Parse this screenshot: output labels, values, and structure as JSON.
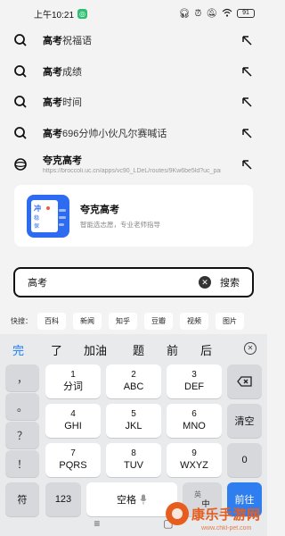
{
  "status_bar": {
    "time": "上午10:21",
    "app_badge": "",
    "battery": "91"
  },
  "suggestions": [
    {
      "highlight": "高考",
      "rest": "祝福语",
      "icon": "search-icon",
      "url": ""
    },
    {
      "highlight": "高考",
      "rest": "成绩",
      "icon": "search-icon",
      "url": ""
    },
    {
      "highlight": "高考",
      "rest": "时间",
      "icon": "search-icon",
      "url": ""
    },
    {
      "highlight": "高考",
      "rest": "696分帅小伙凡尔赛喊话",
      "icon": "search-icon",
      "url": ""
    },
    {
      "highlight": "夸克高考",
      "rest": "",
      "icon": "globe-icon",
      "url": "https://broccoli.uc.cn/apps/vc90_LDeL/routes/9Kw6be5ld?uc_par..."
    }
  ],
  "card": {
    "title": "夸克高考",
    "subtitle": "智能选志愿，专业老师指导",
    "logo_text_1": "冲",
    "logo_text_2": "稳",
    "logo_text_3": "保"
  },
  "search": {
    "value": "高考",
    "clear_icon": "x-circle-icon",
    "button_label": "搜索"
  },
  "quicklinks": {
    "label": "快搜：",
    "items": [
      "百科",
      "新闻",
      "知乎",
      "豆瓣",
      "视频",
      "图片"
    ]
  },
  "keyboard": {
    "candidates": [
      "完",
      "了",
      "加油",
      "题",
      "前",
      "后"
    ],
    "side_keys": [
      "，",
      "。",
      "？",
      "！"
    ],
    "rows": [
      [
        {
          "num": "1",
          "letters": "分词"
        },
        {
          "num": "2",
          "letters": "ABC"
        },
        {
          "num": "3",
          "letters": "DEF"
        }
      ],
      [
        {
          "num": "4",
          "letters": "GHI"
        },
        {
          "num": "5",
          "letters": "JKL"
        },
        {
          "num": "6",
          "letters": "MNO"
        }
      ],
      [
        {
          "num": "7",
          "letters": "PQRS"
        },
        {
          "num": "8",
          "letters": "TUV"
        },
        {
          "num": "9",
          "letters": "WXYZ"
        }
      ]
    ],
    "clear_label": "清空",
    "backspace_icon": "backspace-icon",
    "zero_label": "0",
    "symbol_label": "符",
    "num_label": "123",
    "space_label": "空格",
    "lang_top": "英",
    "lang_bottom": "中",
    "go_label": "前往"
  },
  "watermark": {
    "text": "康乐手游网",
    "url": "www.chkl-pet.com"
  },
  "colors": {
    "accent_blue": "#2f7ef0",
    "watermark_orange": "#e65d1f"
  }
}
